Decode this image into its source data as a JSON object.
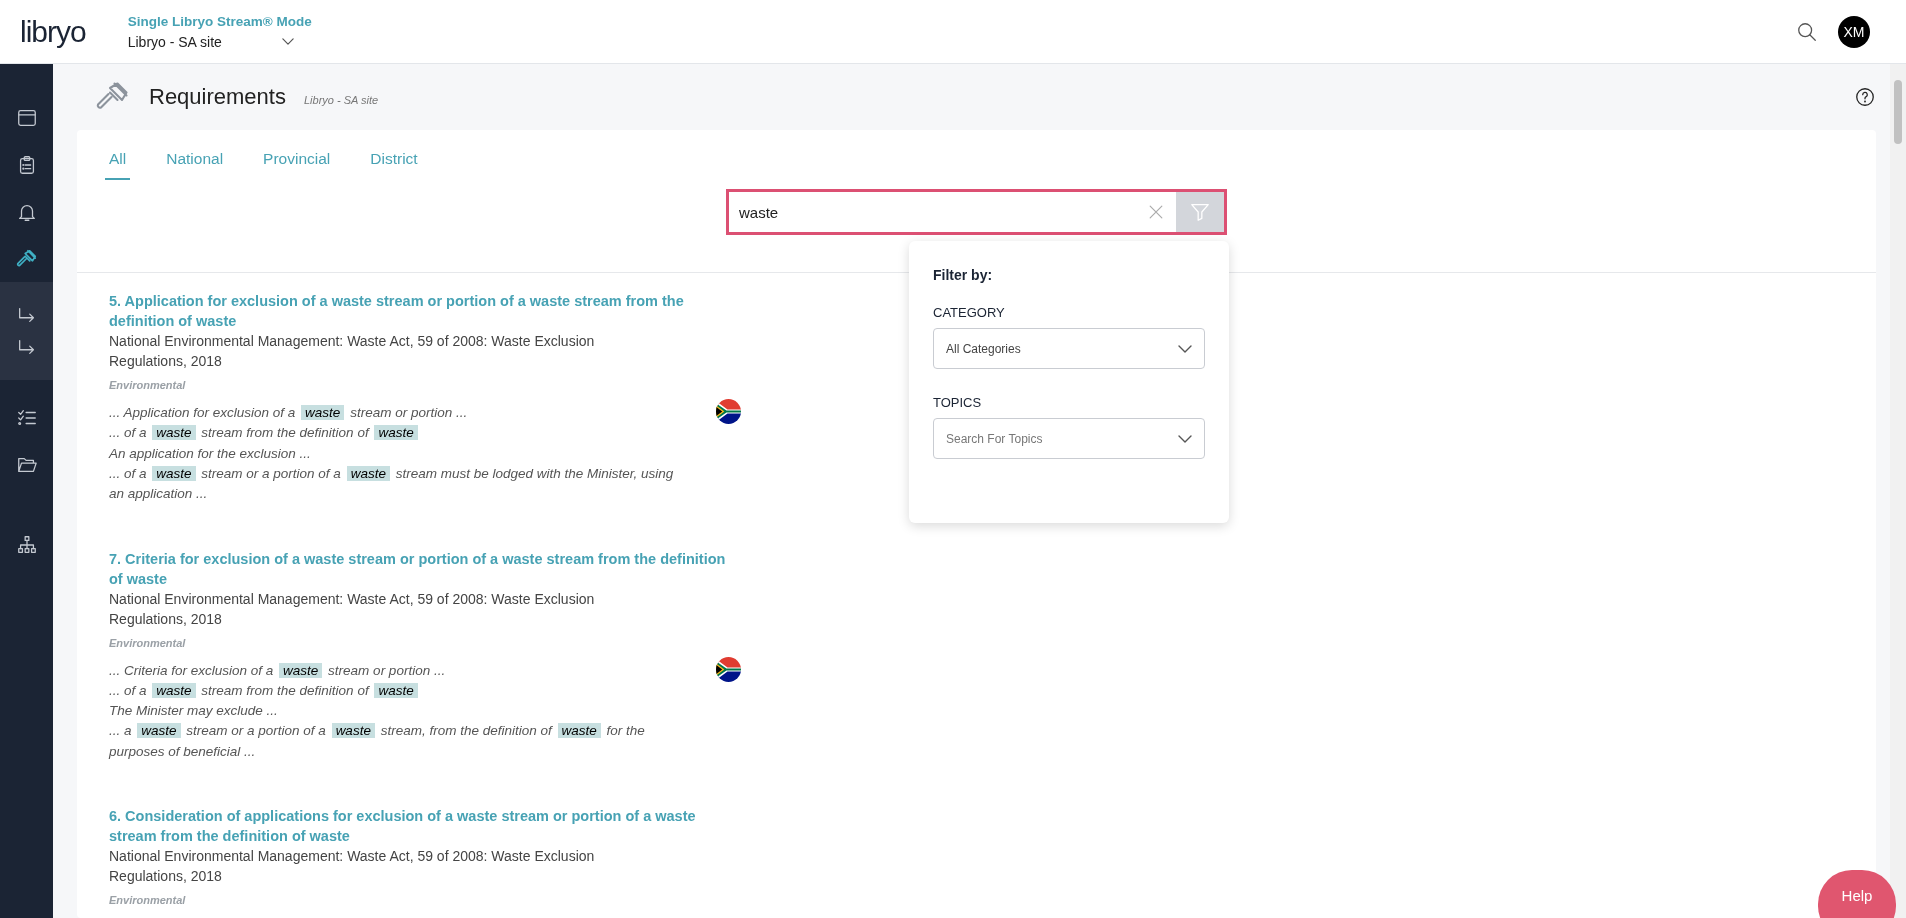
{
  "header": {
    "logo": "libryo",
    "mode_title": "Single Libryo Stream® Mode",
    "site_select": "Libryo - SA site",
    "avatar": "XM"
  },
  "sidebar": {
    "items": [
      {
        "kind": "window",
        "selected": false
      },
      {
        "kind": "clipboard",
        "selected": false
      },
      {
        "kind": "bell",
        "selected": false
      },
      {
        "kind": "gavel",
        "selected": true
      }
    ],
    "group": [
      {
        "kind": "turn-arrow"
      },
      {
        "kind": "turn-arrow"
      }
    ],
    "items_after": [
      {
        "kind": "checklist",
        "selected": false
      },
      {
        "kind": "folder",
        "selected": false
      },
      {
        "kind": "tree",
        "selected": false
      }
    ]
  },
  "page": {
    "title": "Requirements",
    "subtitle": "Libryo - SA site"
  },
  "tabs": [
    {
      "label": "All",
      "selected": true
    },
    {
      "label": "National",
      "selected": false
    },
    {
      "label": "Provincial",
      "selected": false
    },
    {
      "label": "District",
      "selected": false
    }
  ],
  "search": {
    "value": "waste"
  },
  "filter_panel": {
    "title": "Filter by:",
    "fields": [
      {
        "label": "CATEGORY",
        "value": "All Categories"
      },
      {
        "label": "TOPICS",
        "placeholder": "Search For Topics"
      }
    ]
  },
  "results": [
    {
      "title": "5. Application for exclusion of a waste stream or portion of a waste stream from the definition of waste",
      "source": "National Environmental Management: Waste Act, 59 of 2008: Waste Exclusion Regulations, 2018",
      "category": "Environmental",
      "snippets": [
        [
          {
            "text": "... Application for exclusion of a ",
            "highlight": false
          },
          {
            "text": "waste",
            "highlight": true
          },
          {
            "text": " stream or portion ...",
            "highlight": false
          }
        ],
        [
          {
            "text": "... of a ",
            "highlight": false
          },
          {
            "text": "waste",
            "highlight": true
          },
          {
            "text": " stream from the definition of ",
            "highlight": false
          },
          {
            "text": "waste",
            "highlight": true
          }
        ],
        [
          {
            "text": "An application for the exclusion ...",
            "highlight": false
          }
        ],
        [
          {
            "text": "... of a ",
            "highlight": false
          },
          {
            "text": "waste",
            "highlight": true
          },
          {
            "text": " stream or a portion of a ",
            "highlight": false
          },
          {
            "text": "waste",
            "highlight": true
          },
          {
            "text": " stream must be lodged with the Minister, using an application ...",
            "highlight": false
          }
        ]
      ]
    },
    {
      "title": "7. Criteria for exclusion of a waste stream or portion of a waste stream from the definition of waste",
      "source": "National Environmental Management: Waste Act, 59 of 2008: Waste Exclusion Regulations, 2018",
      "category": "Environmental",
      "snippets": [
        [
          {
            "text": "... Criteria for exclusion of a ",
            "highlight": false
          },
          {
            "text": "waste",
            "highlight": true
          },
          {
            "text": " stream or portion ...",
            "highlight": false
          }
        ],
        [
          {
            "text": "... of a ",
            "highlight": false
          },
          {
            "text": "waste",
            "highlight": true
          },
          {
            "text": " stream from the definition of ",
            "highlight": false
          },
          {
            "text": "waste",
            "highlight": true
          }
        ],
        [
          {
            "text": "The Minister may exclude ...",
            "highlight": false
          }
        ],
        [
          {
            "text": "... a ",
            "highlight": false
          },
          {
            "text": "waste",
            "highlight": true
          },
          {
            "text": " stream or a portion of a ",
            "highlight": false
          },
          {
            "text": "waste",
            "highlight": true
          },
          {
            "text": " stream, from the definition of ",
            "highlight": false
          },
          {
            "text": "waste",
            "highlight": true
          },
          {
            "text": " for the purposes of beneficial ...",
            "highlight": false
          }
        ]
      ]
    },
    {
      "title": "6. Consideration of applications for exclusion of a waste stream or portion of a waste stream from the definition of waste",
      "source": "National Environmental Management: Waste Act, 59 of 2008: Waste Exclusion Regulations, 2018",
      "category": "Environmental"
    }
  ],
  "help_button": "Help"
}
